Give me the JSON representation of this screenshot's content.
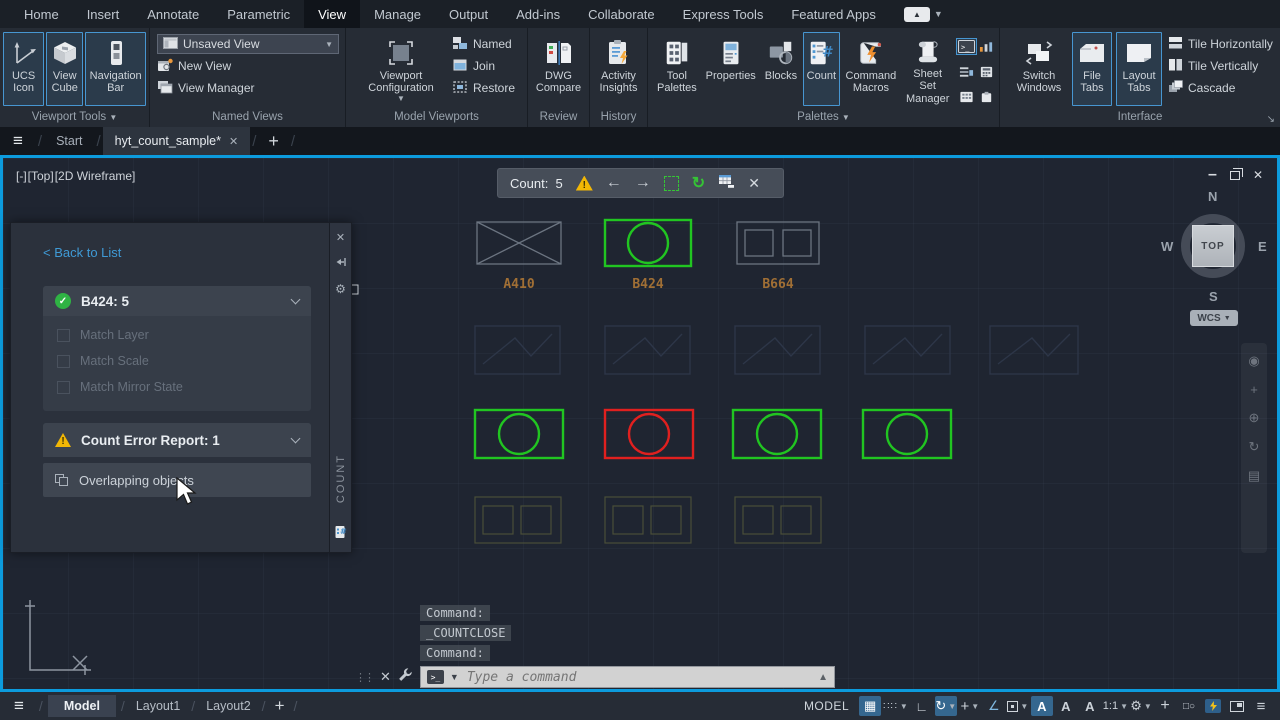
{
  "menubar": {
    "tabs": [
      "Home",
      "Insert",
      "Annotate",
      "Parametric",
      "View",
      "Manage",
      "Output",
      "Add-ins",
      "Collaborate",
      "Express Tools",
      "Featured Apps"
    ],
    "active": "View"
  },
  "ribbon": {
    "viewport_tools": {
      "label": "Viewport Tools",
      "buttons": [
        "UCS Icon",
        "View Cube",
        "Navigation Bar"
      ]
    },
    "named_views": {
      "label": "Named Views",
      "value": "Unsaved View",
      "items": [
        "New View",
        "View Manager"
      ]
    },
    "model_viewports": {
      "label": "Model Viewports",
      "big": "Viewport Configuration",
      "items": [
        "Named",
        "Join",
        "Restore"
      ]
    },
    "review": {
      "label": "Review",
      "button": "DWG Compare"
    },
    "history": {
      "label": "History",
      "button": "Activity Insights"
    },
    "palettes": {
      "label": "Palettes",
      "buttons": [
        "Tool Palettes",
        "Properties",
        "Blocks",
        "Count",
        "Command Macros",
        "Sheet Set Manager"
      ],
      "active": "Count"
    },
    "interface": {
      "label": "Interface",
      "buttons": [
        "Switch Windows",
        "File Tabs",
        "Layout Tabs"
      ],
      "menu": [
        "Tile Horizontally",
        "Tile Vertically",
        "Cascade"
      ]
    }
  },
  "file_tabs": {
    "tabs": [
      "Start",
      "hyt_count_sample*"
    ],
    "active": "hyt_count_sample*"
  },
  "viewport": {
    "controls": [
      "[-]",
      "[Top]",
      "[2D Wireframe]"
    ]
  },
  "count_toolbar": {
    "label": "Count:",
    "value": "5"
  },
  "palette": {
    "back": "< Back to List",
    "block": "B424: 5",
    "options": [
      "Match Layer",
      "Match Scale",
      "Match Mirror State"
    ],
    "error": "Count Error Report: 1",
    "item": "Overlapping objects",
    "tab": "COUNT"
  },
  "viewcube": {
    "n": "N",
    "s": "S",
    "e": "E",
    "w": "W",
    "top": "TOP",
    "wcs": "WCS"
  },
  "drawing": {
    "labels": [
      "A410",
      "B424",
      "B664"
    ]
  },
  "command_line": {
    "history": [
      "Command:",
      "_COUNTCLOSE",
      "Command:"
    ],
    "placeholder": "Type a command"
  },
  "status": {
    "tabs": [
      "Model",
      "Layout1",
      "Layout2"
    ],
    "active": "Model",
    "mode": "MODEL",
    "scale": "1:1"
  },
  "colors": {
    "viewport_border": "#0c9bdd",
    "ribbon_selection": "#4796d1",
    "count_green": "#21c521",
    "error_red": "#e0201f",
    "warning_yellow": "#f2b705",
    "block_label_orange": "#a06f35",
    "link_blue": "#3f9ad6",
    "status_active_bg": "#35678f"
  }
}
